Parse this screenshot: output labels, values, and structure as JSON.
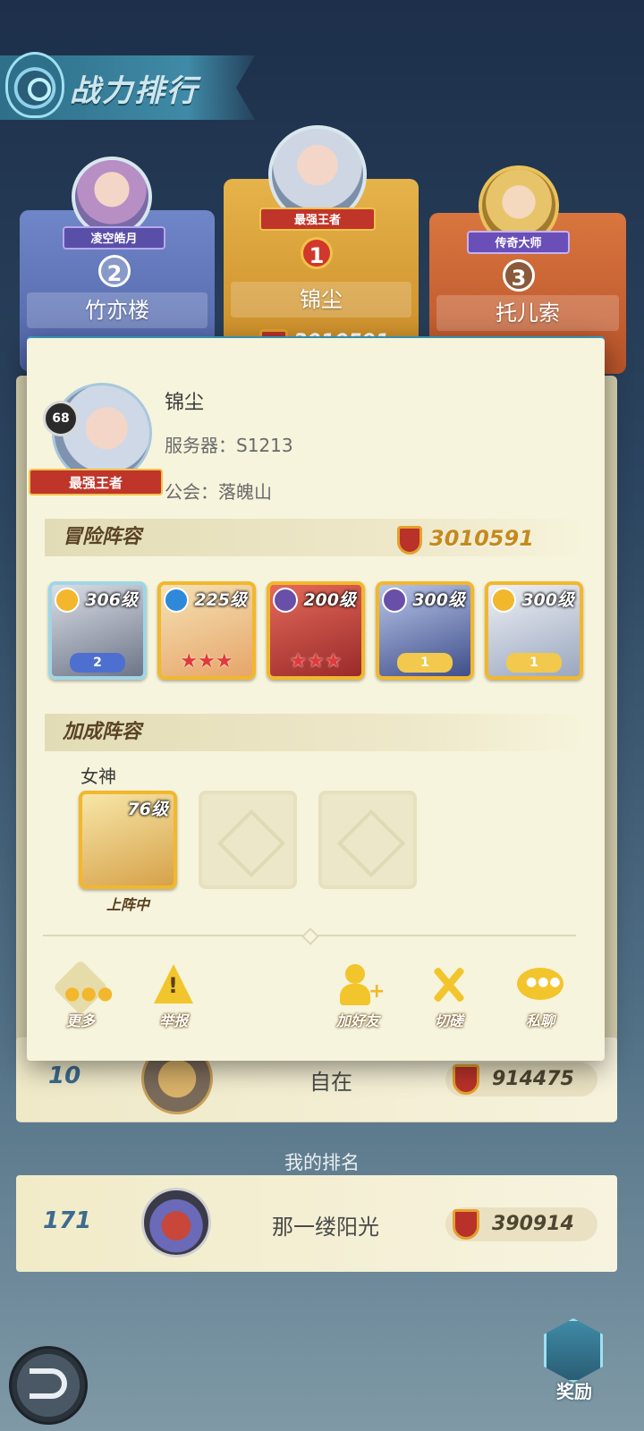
{
  "header": {
    "title": "战力排行"
  },
  "podium": {
    "first": {
      "name": "锦尘",
      "title": "最强王者",
      "rank": "1",
      "score": "3010591"
    },
    "second": {
      "name": "竹亦楼",
      "title": "凌空皓月",
      "rank": "2"
    },
    "third": {
      "name": "托儿索",
      "title": "传奇大师",
      "rank": "3"
    }
  },
  "player_card": {
    "level": "68",
    "title": "最强王者",
    "name": "锦尘",
    "server_label": "服务器：",
    "server": "S1213",
    "guild_label": "公会：",
    "guild": "落魄山"
  },
  "adventure": {
    "section_title": "冒险阵容",
    "power": "3010591",
    "heroes": [
      {
        "level": "306级",
        "badge": "2",
        "stars": "",
        "elem_color": "#f2b72c"
      },
      {
        "level": "225级",
        "badge": "",
        "stars": "★★★",
        "elem_color": "#2e8ad8"
      },
      {
        "level": "200级",
        "badge": "",
        "stars": "★★★",
        "elem_color": "#6a4fa8"
      },
      {
        "level": "300级",
        "badge": "1",
        "stars": "",
        "elem_color": "#6a4fa8"
      },
      {
        "level": "300级",
        "badge": "1",
        "stars": "",
        "elem_color": "#f2b72c"
      }
    ]
  },
  "bonus": {
    "section_title": "加成阵容",
    "goddess_label": "女神",
    "goddess_level": "76级",
    "goddess_status": "上阵中"
  },
  "actions": {
    "more": "更多",
    "report": "举报",
    "add_friend": "加好友",
    "duel": "切磋",
    "chat": "私聊"
  },
  "list": {
    "row10": {
      "rank": "10",
      "name": "自在",
      "score": "914475"
    }
  },
  "my_rank": {
    "label": "我的排名",
    "rank": "171",
    "name": "那一缕阳光",
    "score": "390914"
  },
  "footer": {
    "rewards": "奖励"
  }
}
